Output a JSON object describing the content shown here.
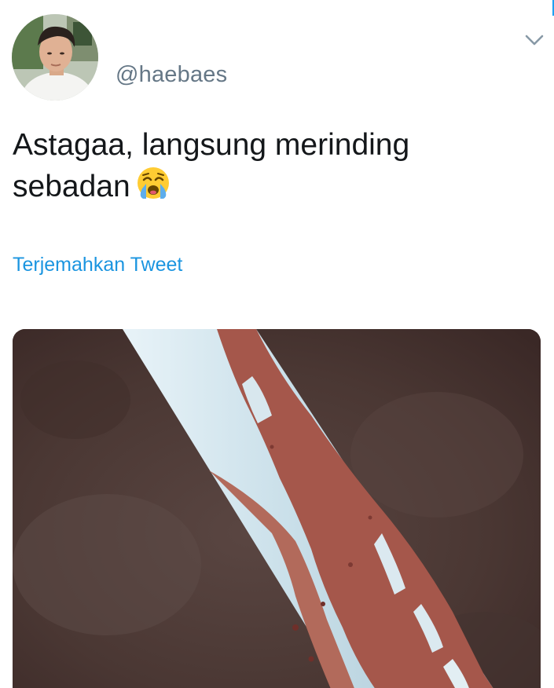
{
  "tweet": {
    "author": {
      "handle": "@haebaes",
      "avatar_icon": "user-avatar-photo"
    },
    "text": "Astagaa, langsung merinding sebadan",
    "emoji": "loudly-crying-face",
    "translate_label": "Terjemahkan Tweet",
    "menu_icon": "chevron-down-icon",
    "media": {
      "type": "video-thumbnail",
      "description_icon": "media-video-still"
    }
  },
  "colors": {
    "handle": "#657786",
    "text": "#14171a",
    "link": "#1b95e0",
    "accent": "#1da1f2"
  }
}
